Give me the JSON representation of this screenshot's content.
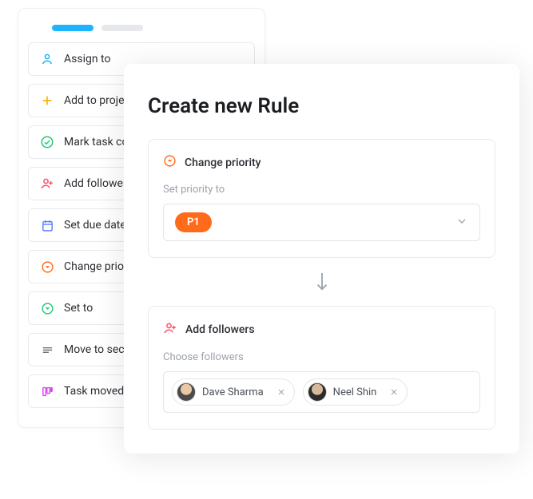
{
  "sidebar": {
    "items": [
      {
        "label": "Assign to",
        "icon": "person-icon",
        "color": "#1db4ff"
      },
      {
        "label": "Add to project",
        "icon": "plus-icon",
        "color": "#f7b500"
      },
      {
        "label": "Mark task complete",
        "icon": "check-circle-icon",
        "color": "#1fc97a"
      },
      {
        "label": "Add followers",
        "icon": "add-person-icon",
        "color": "#ff4d6a"
      },
      {
        "label": "Set due date",
        "icon": "calendar-icon",
        "color": "#5b7cff"
      },
      {
        "label": "Change priority",
        "icon": "priority-down-icon",
        "color": "#ff6b1a"
      },
      {
        "label": "Set to",
        "icon": "priority-down-icon",
        "color": "#1fc97a"
      },
      {
        "label": "Move to section",
        "icon": "move-section-icon",
        "color": "#6b7280"
      },
      {
        "label": "Task moved to",
        "icon": "column-icon",
        "color": "#d946ef"
      }
    ]
  },
  "rule": {
    "title": "Create new Rule",
    "priority": {
      "header": "Change priority",
      "subtitle": "Set priority to",
      "value": "P1"
    },
    "followers": {
      "header": "Add followers",
      "subtitle": "Choose followers",
      "list": [
        {
          "name": "Dave Sharma"
        },
        {
          "name": "Neel Shin"
        }
      ]
    }
  }
}
